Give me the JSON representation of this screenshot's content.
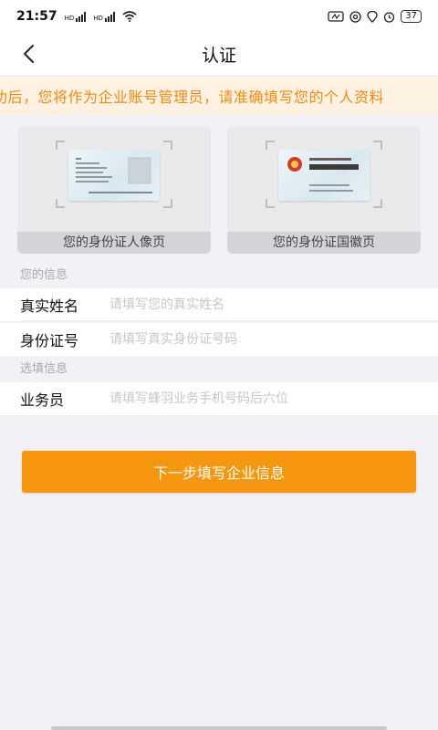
{
  "status_bar": {
    "time": "21:57",
    "signal_label_1": "HD",
    "signal_label_2": "HD",
    "battery": "37"
  },
  "nav": {
    "title": "认证"
  },
  "notice": {
    "text": "功后，您将作为企业账号管理员，请准确填写您的个人资料"
  },
  "id_cards": {
    "front_caption": "您的身份证人像页",
    "back_caption": "您的身份证国徽页",
    "front_image": "id-card-portrait-side",
    "back_image": "id-card-emblem-side"
  },
  "sections": {
    "your_info": "您的信息",
    "optional_info": "选填信息"
  },
  "fields": {
    "real_name": {
      "label": "真实姓名",
      "value": "",
      "placeholder": "请填写您的真实姓名"
    },
    "id_number": {
      "label": "身份证号",
      "value": "",
      "placeholder": "请填写真实身份证号码"
    },
    "salesperson": {
      "label": "业务员",
      "value": "",
      "placeholder": "请填写蜂羽业务手机号码后六位"
    }
  },
  "button": {
    "next_label": "下一步填写企业信息"
  },
  "colors": {
    "accent": "#f7960f",
    "notice_text": "#f08a10",
    "notice_bg": "#fdf1e2",
    "page_bg": "#f2f2f6"
  },
  "icons": {
    "back": "chevron-left-icon",
    "wifi": "wifi-icon",
    "alarm": "alarm-icon"
  }
}
